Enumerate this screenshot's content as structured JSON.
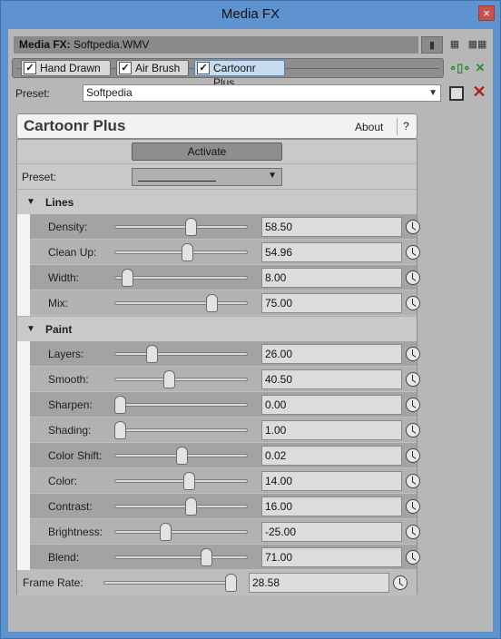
{
  "window": {
    "title": "Media FX",
    "close": "×"
  },
  "header": {
    "media_fx_label": "Media FX:",
    "media_fx_value": "Softpedia.WMV"
  },
  "view_buttons": [
    "▮",
    "▦",
    "▦▦"
  ],
  "chain": [
    {
      "label": "Hand Drawn",
      "checked": true,
      "selected": false
    },
    {
      "label": "Air Brush",
      "checked": true,
      "selected": false
    },
    {
      "label": "Cartoonr Plus",
      "checked": true,
      "selected": true
    }
  ],
  "preset": {
    "label": "Preset:",
    "value": "Softpedia"
  },
  "plugin": {
    "name": "Cartoonr Plus",
    "about": "About",
    "help": "?",
    "activate": "Activate",
    "preset_label": "Preset:"
  },
  "sections": {
    "lines": "Lines",
    "paint": "Paint"
  },
  "params": [
    {
      "label": "Density:",
      "value": "58.50",
      "pos": 0.585
    },
    {
      "label": "Clean Up:",
      "value": "54.96",
      "pos": 0.55
    },
    {
      "label": "Width:",
      "value": "8.00",
      "pos": 0.06
    },
    {
      "label": "Mix:",
      "value": "75.00",
      "pos": 0.75
    },
    {
      "label": "Layers:",
      "value": "26.00",
      "pos": 0.26
    },
    {
      "label": "Smooth:",
      "value": "40.50",
      "pos": 0.405
    },
    {
      "label": "Sharpen:",
      "value": "0.00",
      "pos": 0.0
    },
    {
      "label": "Shading:",
      "value": "1.00",
      "pos": 0.0
    },
    {
      "label": "Color Shift:",
      "value": "0.02",
      "pos": 0.51
    },
    {
      "label": "Color:",
      "value": "14.00",
      "pos": 0.57
    },
    {
      "label": "Contrast:",
      "value": "16.00",
      "pos": 0.58
    },
    {
      "label": "Brightness:",
      "value": "-25.00",
      "pos": 0.375
    },
    {
      "label": "Blend:",
      "value": "71.00",
      "pos": 0.71
    }
  ],
  "frame_rate": {
    "label": "Frame Rate:",
    "value": "28.58",
    "pos": 1.0
  }
}
